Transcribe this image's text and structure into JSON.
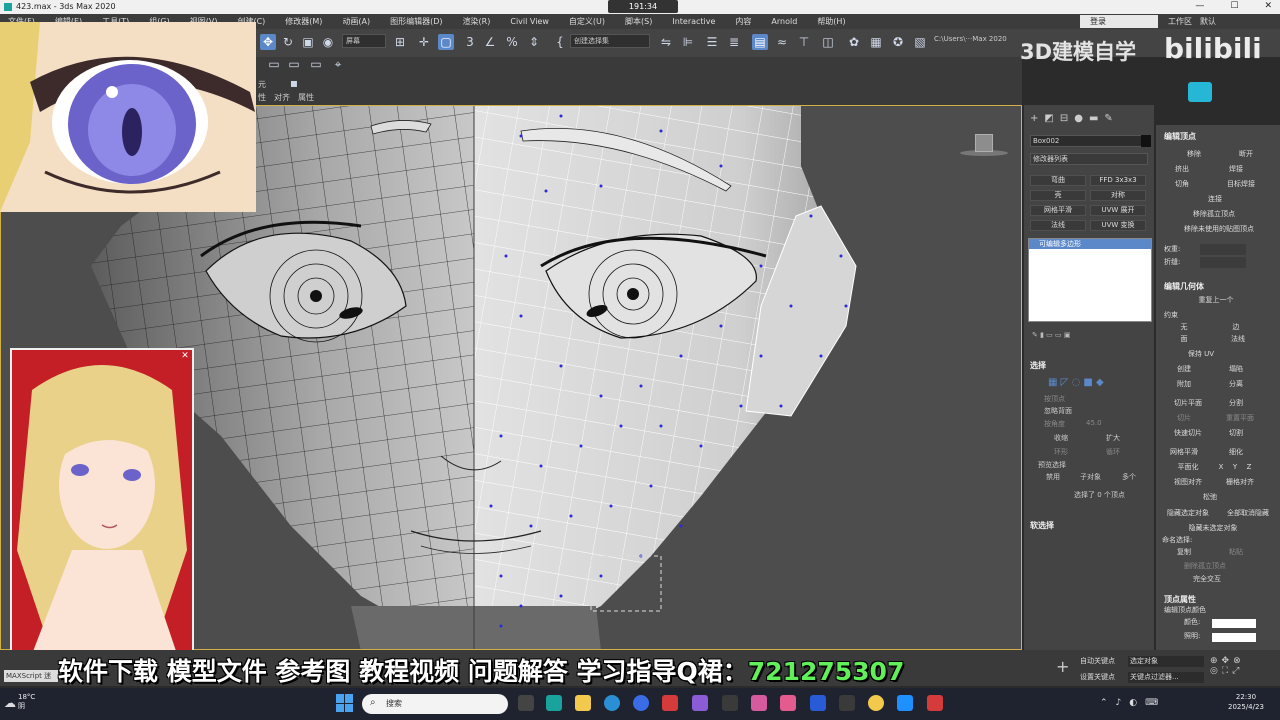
{
  "window": {
    "title": "423.max - 3ds Max 2020",
    "clock": "191:34",
    "controls": [
      "—",
      "☐",
      "✕"
    ]
  },
  "menu": {
    "items": [
      "文件(F)",
      "编辑(E)",
      "工具(T)",
      "组(G)",
      "视图(V)",
      "创建(C)",
      "修改器(M)",
      "动画(A)",
      "图形编辑器(D)",
      "渲染(R)",
      "Civil View",
      "自定义(U)",
      "脚本(S)",
      "Interactive",
      "内容",
      "Arnold",
      "帮助(H)"
    ],
    "login": "登录",
    "workspace": "工作区",
    "workspace_value": "默认"
  },
  "toolbar": {
    "refcoord": "屏幕",
    "selection_set": "创建选择集",
    "path": "C:\\Users\\···Max 2020"
  },
  "ribbon": {
    "labels": [
      "元",
      "性",
      "对齐",
      "属性"
    ]
  },
  "branding": {
    "channel": "3D建模自学",
    "site": "bilibili"
  },
  "command_panel": {
    "object_name": "Box002",
    "modifier_list": "修改器列表",
    "buttons": [
      "弯曲",
      "FFD 3x3x3",
      "壳",
      "对称",
      "网格平滑",
      "UVW 展开",
      "法线",
      "UVW 变换"
    ],
    "stack_item": "可编辑多边形",
    "selection_title": "选择",
    "by_vertex": "按顶点",
    "ignore_backfacing": "忽略背面",
    "by_angle": "按角度",
    "angle_value": "45.0",
    "shrink": "收缩",
    "grow": "扩大",
    "ring": "环形",
    "loop": "循环",
    "preview_selection": "预览选择",
    "preview_options": [
      "禁用",
      "子对象",
      "多个"
    ],
    "selected_count": "选择了 0 个顶点",
    "soft_selection": "软选择"
  },
  "edit_vertices": {
    "title": "编辑顶点",
    "remove": "移除",
    "break": "断开",
    "extrude": "挤出",
    "weld": "焊接",
    "chamfer": "切角",
    "target_weld": "目标焊接",
    "connect": "连接",
    "remove_isolated": "移除孤立顶点",
    "remove_unused": "移除未使用的贴图顶点",
    "weight_label": "权重:",
    "crease_label": "折缝:",
    "edit_geometry": "编辑几何体",
    "repeat_last": "重复上一个",
    "constraints": "约束",
    "constraint_options": [
      "无",
      "边",
      "面",
      "法线"
    ],
    "preserve_uv": "保持 UV",
    "create": "创建",
    "collapse": "塌陷",
    "attach": "附加",
    "detach": "分离",
    "slice_plane": "切片平面",
    "split": "分割",
    "slice": "切片",
    "reset_plane": "重置平面",
    "quickslice": "快速切片",
    "cut": "切割",
    "meshsmooth": "网格平滑",
    "tessellate": "细化",
    "make_planar": "平面化",
    "axes": [
      "X",
      "Y",
      "Z"
    ],
    "view_align": "视图对齐",
    "grid_align": "栅格对齐",
    "relax": "松弛",
    "hide_selected": "隐藏选定对象",
    "unhide_all": "全部取消隐藏",
    "hide_unselected": "隐藏未选定对象",
    "named_selections": "命名选择:",
    "copy": "复制",
    "paste": "粘贴",
    "delete_isolated": "删除孤立顶点",
    "full_interactivity": "完全交互",
    "vertex_props": "顶点属性",
    "edit_vertex_colors": "编辑顶点颜色",
    "color_label": "颜色:",
    "illum_label": "照明:"
  },
  "status": {
    "maxscript": "MAXScript 迷",
    "autokey": "自动关键点",
    "setkey": "设置关键点",
    "selected_object": "选定对象",
    "key_filters": "关键点过滤器..."
  },
  "banner": {
    "text": "软件下载 模型文件 参考图 教程视频 问题解答 学习指导Q裙：",
    "number": "721275307"
  },
  "taskbar": {
    "temp": "18°C",
    "weather": "阴",
    "search": "搜索",
    "time": "22:30",
    "date": "2025/4/23"
  },
  "colors": {
    "accent": "#5b88c9",
    "viewport_border": "#d2b046",
    "banner_number": "#61f05a",
    "wire_vertex": "#2a2ad8",
    "camera_bg": "#c41f26"
  }
}
